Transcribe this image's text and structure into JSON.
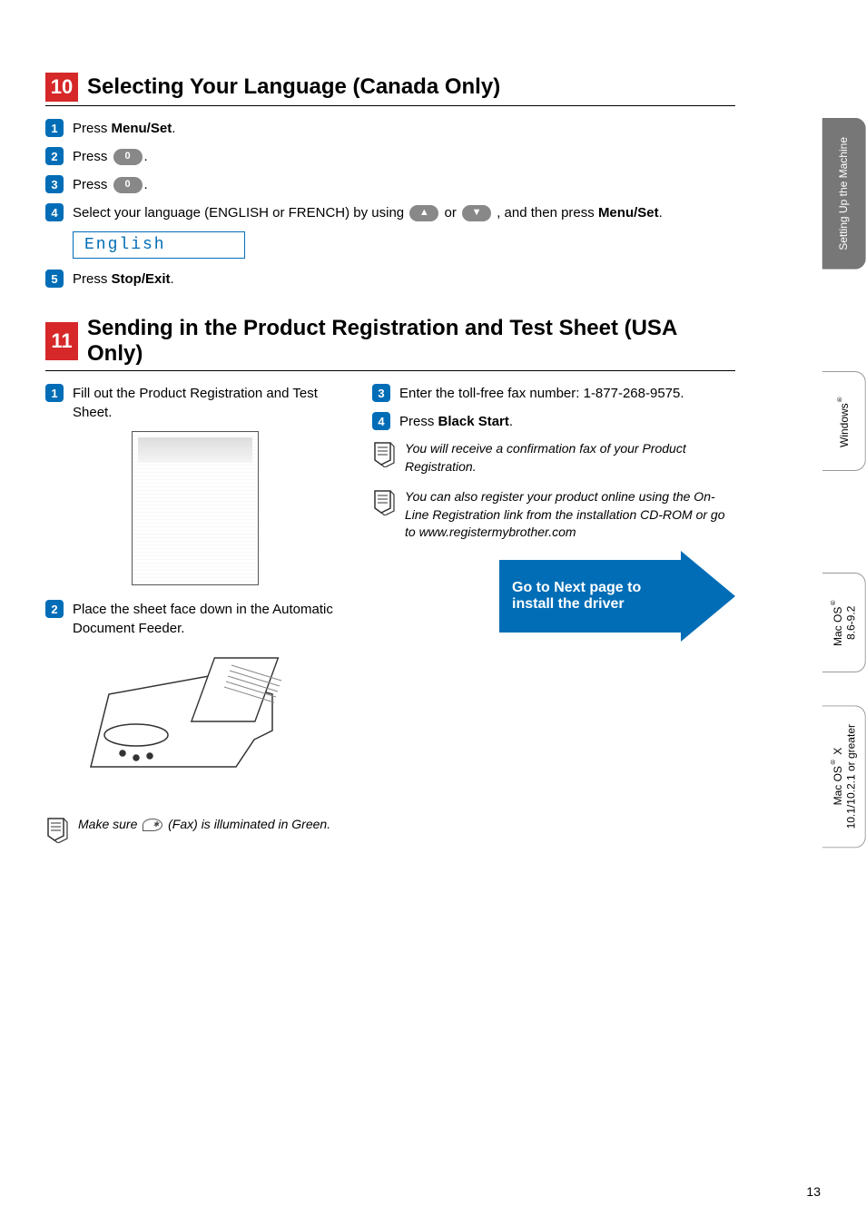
{
  "section10": {
    "number": "10",
    "title": "Selecting Your Language (Canada Only)",
    "steps": {
      "s1_a": "Press ",
      "s1_b": "Menu/Set",
      "s1_c": ".",
      "s2_a": "Press ",
      "s2_key": "0",
      "s2_c": ".",
      "s3_a": "Press ",
      "s3_key": "0",
      "s3_c": ".",
      "s4_a": "Select your language (ENGLISH or FRENCH) by using ",
      "s4_b": " or ",
      "s4_c": " , and then press ",
      "s4_d": "Menu/Set",
      "s4_e": ".",
      "lcd": "English",
      "s5_a": "Press ",
      "s5_b": "Stop/Exit",
      "s5_c": "."
    }
  },
  "section11": {
    "number": "11",
    "title": "Sending in the Product Registration and Test Sheet (USA Only)",
    "left": {
      "s1": "Fill out the Product Registration and Test Sheet.",
      "s2": "Place the sheet face down in the Automatic Document Feeder.",
      "note_a": "Make sure ",
      "note_b": " (Fax) is illuminated in Green."
    },
    "right": {
      "s3": "Enter the toll-free fax number: 1-877-268-9575.",
      "s4_a": "Press ",
      "s4_b": "Black Start",
      "s4_c": ".",
      "note1": "You will receive a confirmation fax of your Product Registration.",
      "note2": "You can also register your product online using the On-Line Registration link from the installation CD-ROM or go to www.registermybrother.com"
    },
    "arrow": "Go to Next page to install the driver"
  },
  "tabs": {
    "t1": "Setting Up\nthe Machine",
    "t2": "Windows®",
    "t3": "Mac OS®\n8.6-9.2",
    "t4": "Mac OS® X\n10.1/10.2.1 or greater"
  },
  "pageNumber": "13"
}
